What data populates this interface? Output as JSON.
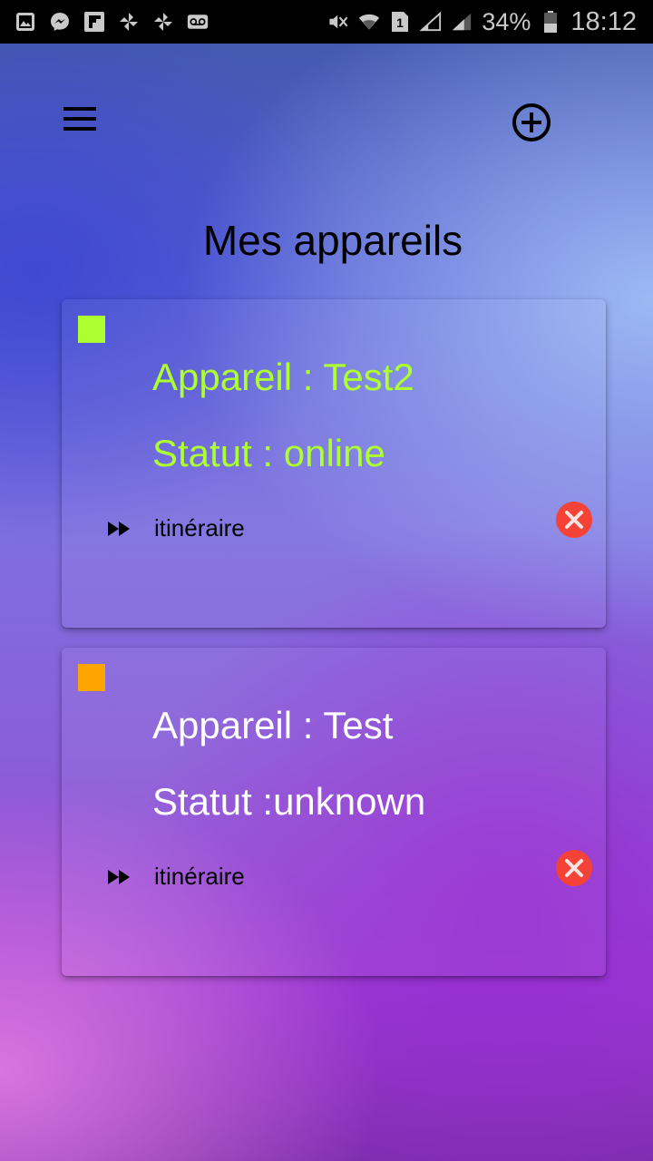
{
  "status_bar": {
    "battery_percent": "34%",
    "time": "18:12",
    "left_icons": [
      "gallery-icon",
      "messenger-icon",
      "flipboard-icon",
      "pinwheel-icon",
      "pinwheel-icon",
      "voicemail-icon"
    ],
    "right_icons": [
      "mute-icon",
      "wifi-icon",
      "sim1-icon",
      "signal-icon",
      "signal-icon",
      "battery-icon"
    ]
  },
  "header": {
    "menu_icon": "hamburger-menu-icon",
    "add_icon": "add-circle-icon",
    "title": "Mes appareils"
  },
  "devices": [
    {
      "name_line": "Appareil : Test2",
      "status_line": "Statut : online",
      "status_color": "#adff2f",
      "text_color": "#adff2f",
      "route_icon": "fast-forward-icon",
      "route_label": "itinéraire",
      "delete_icon": "close-circle-icon"
    },
    {
      "name_line": "Appareil : Test",
      "status_line": "Statut :unknown",
      "status_color": "#ffa500",
      "text_color": "#ffffff",
      "route_icon": "fast-forward-icon",
      "route_label": "itinéraire",
      "delete_icon": "close-circle-icon"
    }
  ],
  "colors": {
    "delete_red": "#f44336",
    "status_bar_bg": "#000000"
  }
}
